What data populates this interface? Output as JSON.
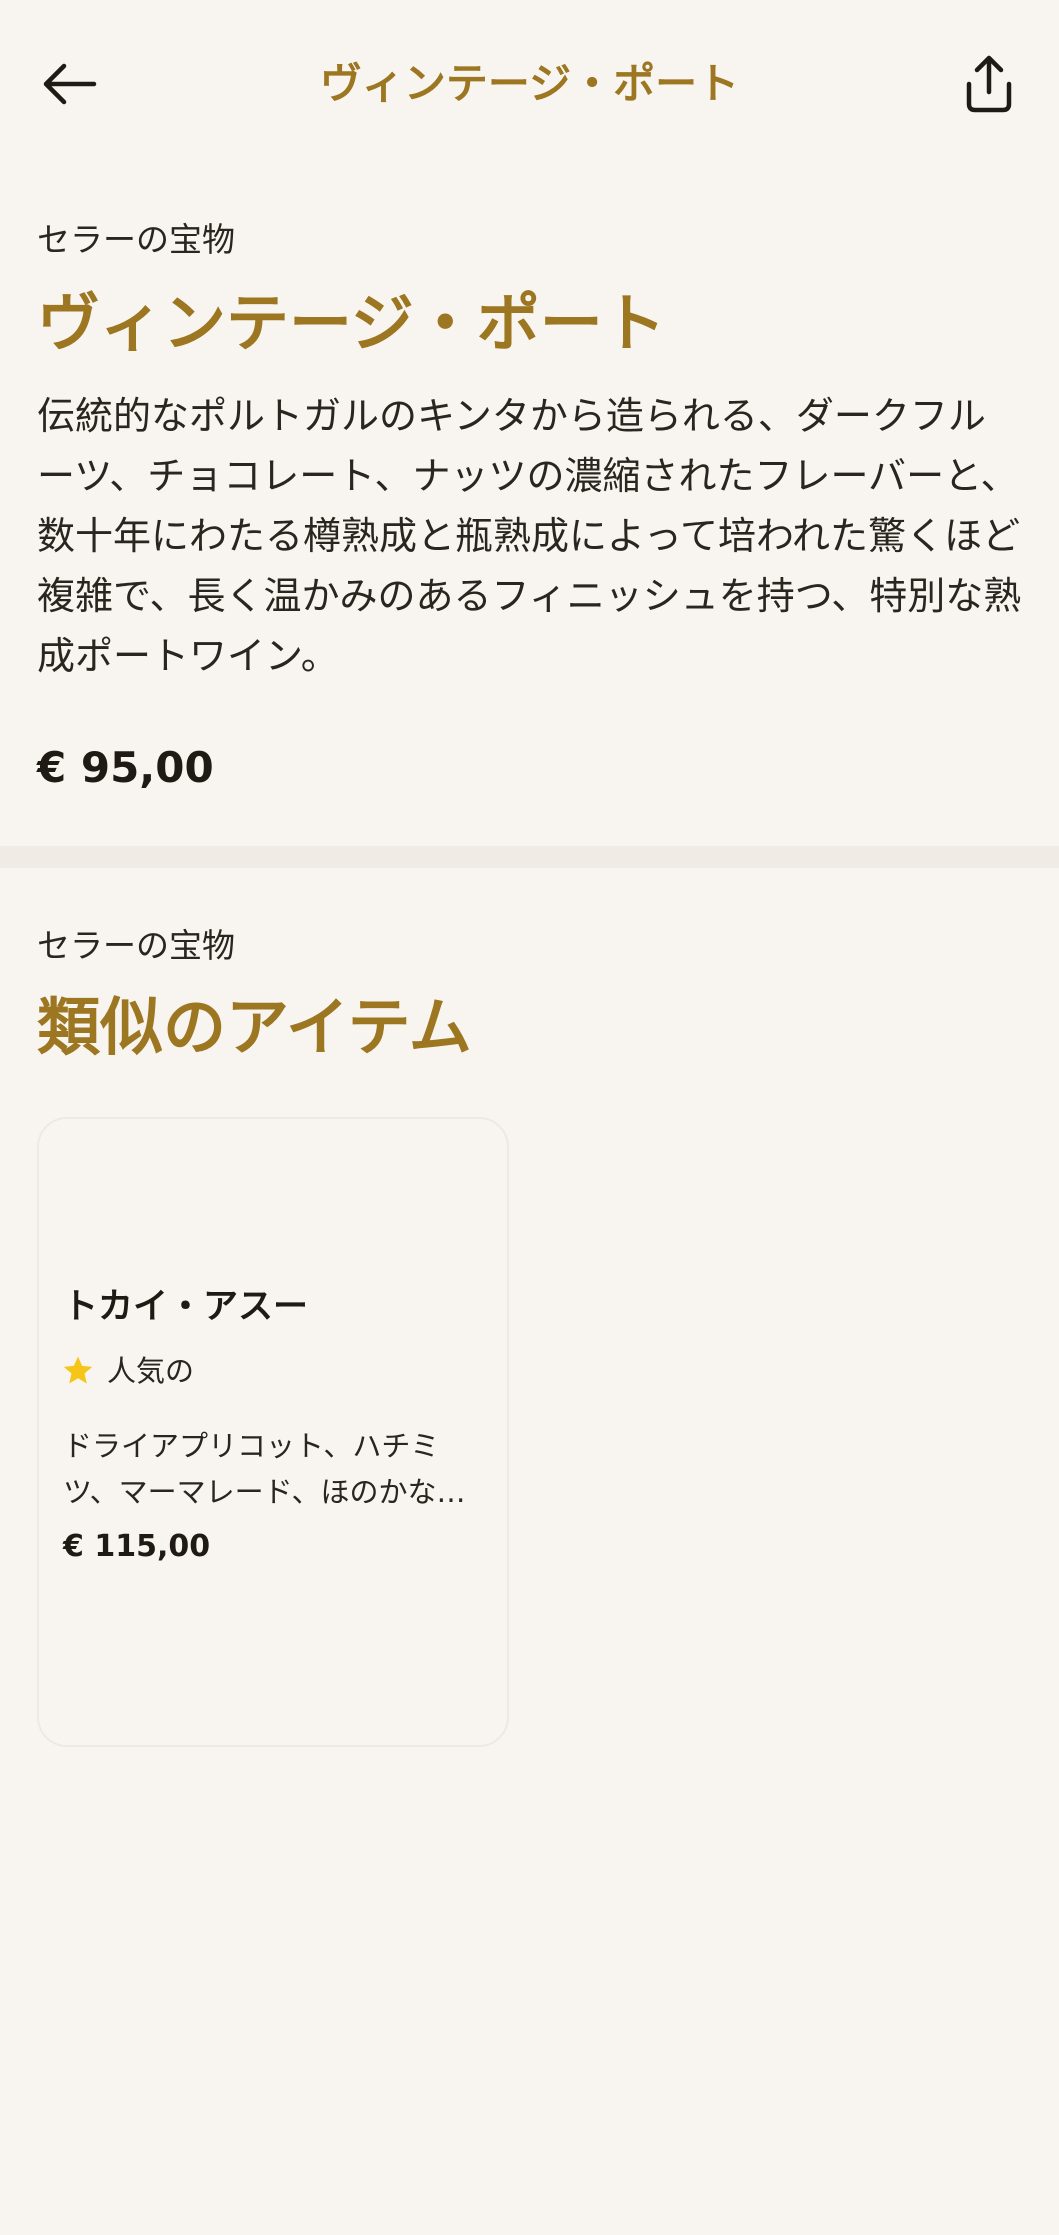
{
  "header": {
    "title": "ヴィンテージ・ポート",
    "back_icon": "arrow-left-icon",
    "share_icon": "share-icon"
  },
  "product": {
    "category": "セラーの宝物",
    "title": "ヴィンテージ・ポート",
    "description": "伝統的なポルトガルのキンタから造られる、ダークフルーツ、チョコレート、ナッツの濃縮されたフレーバーと、数十年にわたる樽熟成と瓶熟成によって培われた驚くほど複雑で、長く温かみのあるフィニッシュを持つ、特別な熟成ポートワイン。",
    "price": "€ 95,00"
  },
  "similar": {
    "category": "セラーの宝物",
    "title": "類似のアイテム",
    "items": [
      {
        "name": "トカイ・アスー",
        "rating_label": "人気の",
        "rating_icon": "star-icon",
        "description": "ドライアプリコット、ハチミツ、マーマレード、ほのかなスパイスの風味",
        "price": "€ 115,00"
      }
    ]
  },
  "colors": {
    "background": "#f8f5f0",
    "accent": "#9c7620",
    "star": "#f5c518",
    "text": "#1f1a14"
  }
}
